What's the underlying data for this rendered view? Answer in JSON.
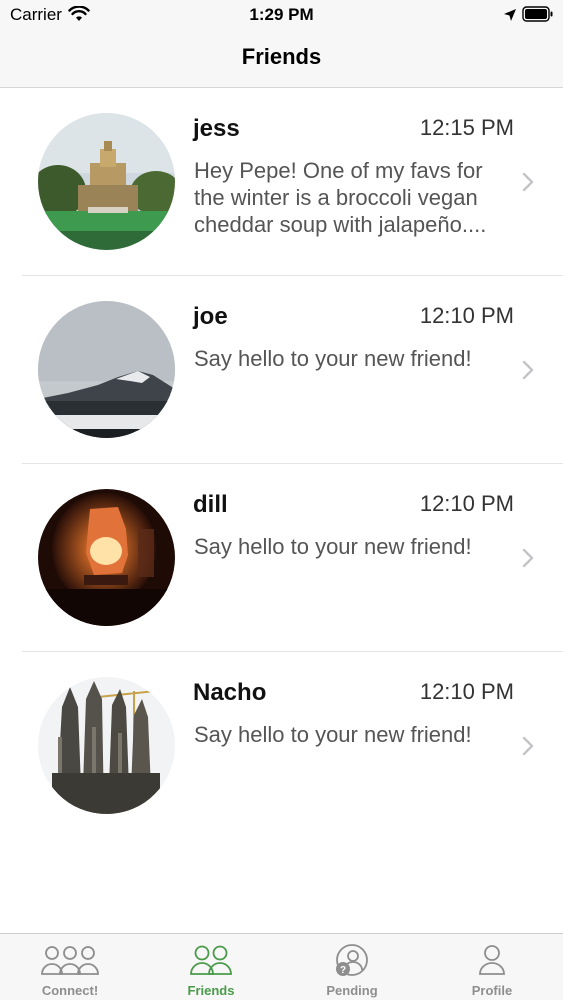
{
  "status_bar": {
    "carrier": "Carrier",
    "time": "1:29 PM",
    "icons": [
      "wifi-icon",
      "location-icon",
      "battery-icon"
    ]
  },
  "nav": {
    "title": "Friends"
  },
  "friends": [
    {
      "name": "jess",
      "time": "12:15 PM",
      "message": "Hey Pepe! One of my favs for the winter is a broccoli vegan cheddar soup with jalapeño....",
      "avatar": "fountain-photo"
    },
    {
      "name": "joe",
      "time": "12:10 PM",
      "message": "Say hello to your new friend!",
      "avatar": "mountain-photo"
    },
    {
      "name": "dill",
      "time": "12:10 PM",
      "message": "Say hello to your new friend!",
      "avatar": "salt-lamp-photo"
    },
    {
      "name": "Nacho",
      "time": "12:10 PM",
      "message": "Say hello to your new friend!",
      "avatar": "cathedral-photo"
    }
  ],
  "tabs": [
    {
      "label": "Connect!",
      "icon": "group-icon",
      "active": false
    },
    {
      "label": "Friends",
      "icon": "friends-icon",
      "active": true
    },
    {
      "label": "Pending",
      "icon": "pending-user-icon",
      "active": false
    },
    {
      "label": "Profile",
      "icon": "profile-icon",
      "active": false
    }
  ],
  "colors": {
    "accent": "#4a9a4a",
    "inactive": "#8e8e8e",
    "bar_bg": "#f7f7f7"
  }
}
